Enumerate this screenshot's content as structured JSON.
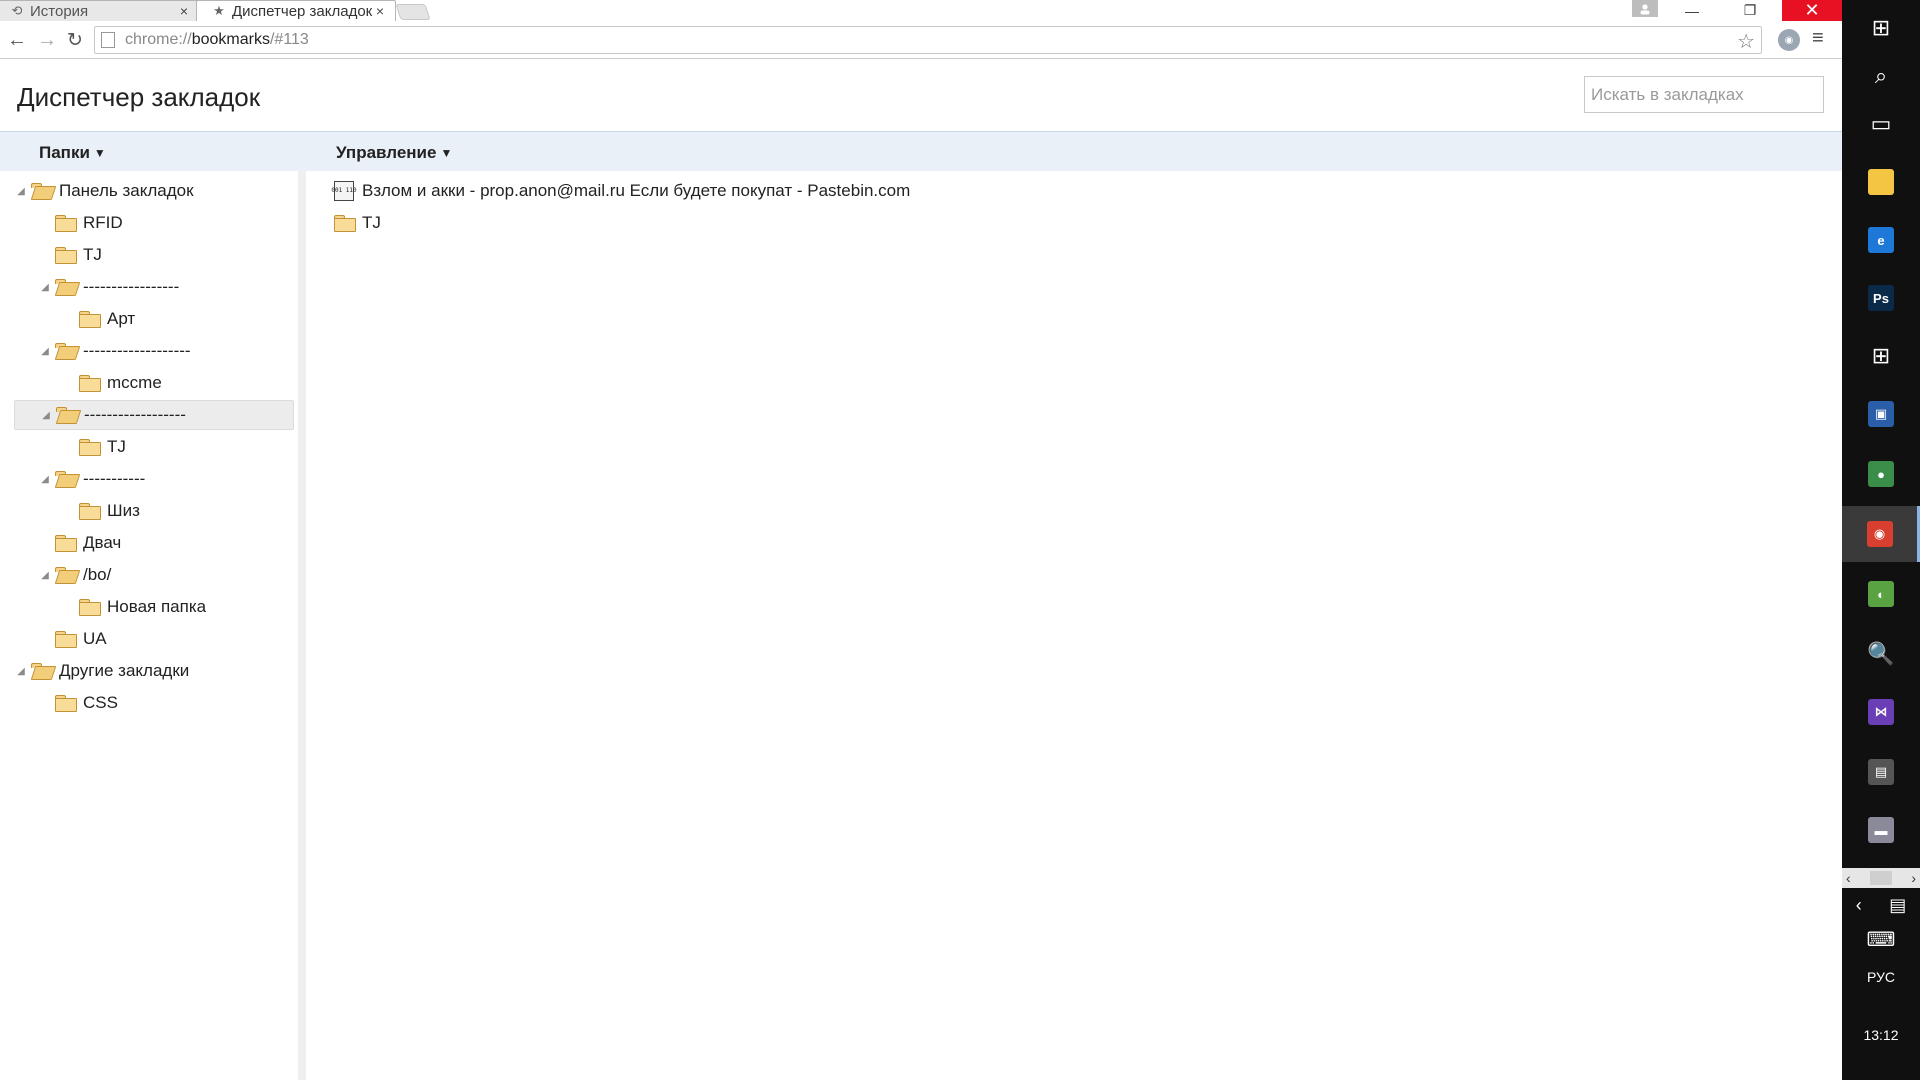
{
  "tabs": [
    {
      "title": "История",
      "icon": "history-icon",
      "close": "×"
    },
    {
      "title": "Диспетчер закладок",
      "icon": "star-icon",
      "close": "×"
    }
  ],
  "window_controls": {
    "minimize": "—",
    "maximize": "❐",
    "close": "✕"
  },
  "toolbar": {
    "back": "←",
    "forward": "→",
    "reload": "↻",
    "url_scheme": "chrome://",
    "url_host": "bookmarks",
    "url_path": "/#113",
    "star": "☆",
    "menu": "≡"
  },
  "page": {
    "title": "Диспетчер закладок",
    "search_placeholder": "Искать в закладках",
    "folders_menu": "Папки",
    "organize_menu": "Управление",
    "caret": "▼"
  },
  "tree": [
    {
      "label": "Панель закладок",
      "depth": 0,
      "expanded": true,
      "selected": false
    },
    {
      "label": "RFID",
      "depth": 1,
      "expanded": false,
      "selected": false
    },
    {
      "label": "TJ",
      "depth": 1,
      "expanded": false,
      "selected": false
    },
    {
      "label": "-----------------",
      "depth": 1,
      "expanded": true,
      "selected": false
    },
    {
      "label": "Арт",
      "depth": 2,
      "expanded": false,
      "selected": false
    },
    {
      "label": "-------------------",
      "depth": 1,
      "expanded": true,
      "selected": false
    },
    {
      "label": "mccme",
      "depth": 2,
      "expanded": false,
      "selected": false
    },
    {
      "label": "------------------",
      "depth": 1,
      "expanded": true,
      "selected": true
    },
    {
      "label": "TJ",
      "depth": 2,
      "expanded": false,
      "selected": false
    },
    {
      "label": "-----------",
      "depth": 1,
      "expanded": true,
      "selected": false
    },
    {
      "label": "Шиз",
      "depth": 2,
      "expanded": false,
      "selected": false
    },
    {
      "label": "Двач",
      "depth": 1,
      "expanded": false,
      "selected": false
    },
    {
      "label": "/bo/",
      "depth": 1,
      "expanded": true,
      "selected": false
    },
    {
      "label": "Новая папка",
      "depth": 2,
      "expanded": false,
      "selected": false
    },
    {
      "label": "UA",
      "depth": 1,
      "expanded": false,
      "selected": false
    },
    {
      "label": "Другие закладки",
      "depth": 0,
      "expanded": true,
      "selected": false
    },
    {
      "label": "CSS",
      "depth": 1,
      "expanded": false,
      "selected": false
    }
  ],
  "tree_twisty": "◢",
  "list": [
    {
      "type": "bookmark",
      "label": "Взлом и акки - prop.anon@mail.ru Если будете покупат - Pastebin.com",
      "favicon_text": "001 110"
    },
    {
      "type": "folder",
      "label": "TJ"
    }
  ],
  "taskbar": {
    "items": [
      {
        "name": "start-windows-icon",
        "glyph": "⊞",
        "bg": ""
      },
      {
        "name": "search-icon",
        "glyph": "⌕",
        "bg": ""
      },
      {
        "name": "task-view-icon",
        "glyph": "▭",
        "bg": ""
      },
      {
        "name": "file-explorer-icon",
        "glyph": "",
        "bg": "#f4c542"
      },
      {
        "name": "edge-icon",
        "glyph": "e",
        "bg": "#1e78d7"
      },
      {
        "name": "photoshop-icon",
        "glyph": "Ps",
        "bg": "#0b2a4a"
      },
      {
        "name": "store-icon",
        "glyph": "⊞",
        "bg": ""
      },
      {
        "name": "virtualbox-icon",
        "glyph": "▣",
        "bg": "#2a5ea8"
      },
      {
        "name": "globe-app-icon",
        "glyph": "●",
        "bg": "#3b8e4a"
      },
      {
        "name": "chrome-icon",
        "glyph": "◉",
        "bg": "#d93f2f"
      },
      {
        "name": "map-app-icon",
        "glyph": "◐",
        "bg": "#5aa342"
      },
      {
        "name": "document-search-icon",
        "glyph": "🔍",
        "bg": ""
      },
      {
        "name": "visual-studio-icon",
        "glyph": "⋈",
        "bg": "#6a3fb5"
      },
      {
        "name": "media-app-icon",
        "glyph": "▤",
        "bg": "#555555"
      },
      {
        "name": "printer-app-icon",
        "glyph": "▬",
        "bg": "#8a8a9a"
      }
    ],
    "tray_left": "‹",
    "tray_right": "›",
    "chevron": "‹",
    "notifications": "▤",
    "keyboard": "⌨",
    "language": "РУС",
    "time": "13:12"
  }
}
